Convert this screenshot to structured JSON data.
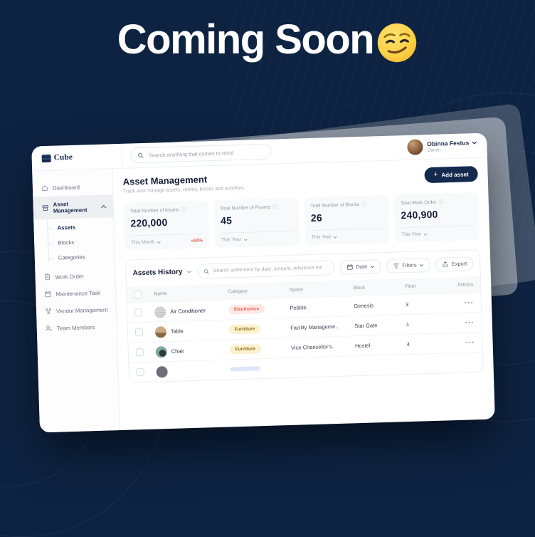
{
  "banner": {
    "title": "Coming Soon",
    "emoji": "smirking-face"
  },
  "app": {
    "logo_text": "Cube",
    "search_placeholder": "Search anything that comes to mind",
    "user": {
      "name": "Obinna Festus",
      "role": "Owner"
    }
  },
  "sidebar": {
    "items": [
      {
        "label": "Dashboard",
        "icon": "home-icon"
      },
      {
        "label": "Asset Management",
        "icon": "archive-box-icon",
        "active": true
      },
      {
        "label": "Work Order",
        "icon": "clipboard-icon"
      },
      {
        "label": "Maintenance Task",
        "icon": "calendar-icon"
      },
      {
        "label": "Vendor Management",
        "icon": "network-icon"
      },
      {
        "label": "Team Members",
        "icon": "users-icon"
      }
    ],
    "asset_children": [
      {
        "label": "Assets",
        "active": true
      },
      {
        "label": "Blocks"
      },
      {
        "label": "Categories"
      }
    ]
  },
  "page": {
    "title": "Asset Management",
    "subtitle": "Track and manage assets, rooms, blocks and activities.",
    "add_plus": "+",
    "add_button": "Add asset"
  },
  "stats": [
    {
      "label": "Total Number of Assets",
      "value": "220,000",
      "period": "This Month",
      "delta": "+24%"
    },
    {
      "label": "Total Number of Rooms",
      "value": "45",
      "period": "This Year",
      "delta": ""
    },
    {
      "label": "Total Number of Blocks",
      "value": "26",
      "period": "This Year",
      "delta": ""
    },
    {
      "label": "Total Work Order",
      "value": "240,900",
      "period": "This Year",
      "delta": ""
    }
  ],
  "history": {
    "title": "Assets History",
    "search_placeholder": "Search settlement by date, amount, reference etc",
    "date_button": "Date",
    "filters_button": "Filters",
    "export_button": "Export",
    "row_action_label": "•••",
    "columns": [
      "Name",
      "Category",
      "Space",
      "Block",
      "Floor",
      "Actions"
    ],
    "rows": [
      {
        "name": "Air Conditioner",
        "category": "Electronics",
        "badge_style": "background:#FCE9E6;color:#E25C4A",
        "avatar_style": "background:repeating-linear-gradient(#d9d9d9 0 2px,#bdbdbd 2px 3px)",
        "space": "Pebble",
        "block": "Genesis",
        "floor": "3"
      },
      {
        "name": "Table",
        "category": "Furniture",
        "badge_style": "background:#FBF1CB;color:#8A6D1A",
        "avatar_style": "background:linear-gradient(#cdab82 55%,#8a6a45 55%)",
        "space": "Facility Manageme..",
        "block": "Star Gate",
        "floor": "1"
      },
      {
        "name": "Chair",
        "category": "Furniture",
        "badge_style": "background:#FBF1CB;color:#8A6D1A",
        "avatar_style": "background:radial-gradient(circle at 60% 60%,#2e3b3c 0 35%,#7fa7a3 36%)",
        "space": "Vice Chancellor's..",
        "block": "Hostel",
        "floor": "4"
      },
      {
        "name": "",
        "category": "",
        "badge_style": "background:#DFE6F9;color:#5B74C7",
        "avatar_style": "background:#6d7078",
        "space": "",
        "block": "",
        "floor": ""
      }
    ]
  },
  "colors": {
    "background_navy": "#0E2342",
    "brand_navy": "#14294E",
    "delta_red": "#E25C4A",
    "badge_red_bg": "#FCE9E6",
    "badge_yellow_bg": "#FBF1CB",
    "badge_blue_bg": "#DFE6F9"
  }
}
